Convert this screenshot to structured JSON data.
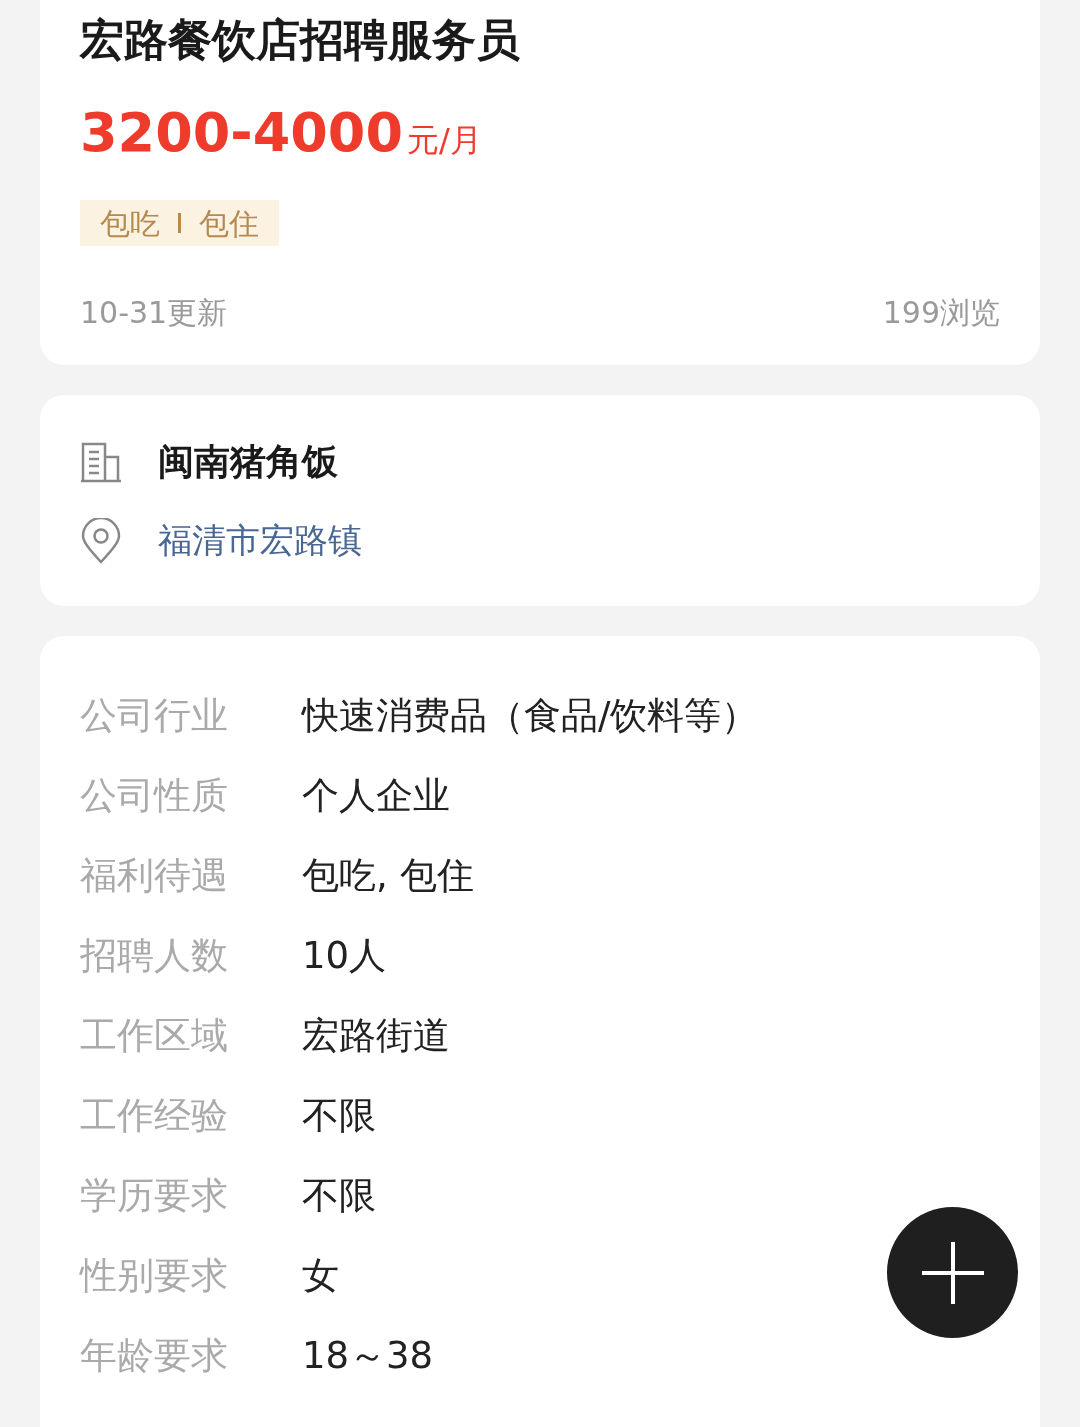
{
  "job": {
    "title": "宏路餐饮店招聘服务员",
    "salary": "3200-4000",
    "salary_unit": "元/月",
    "tags": [
      "包吃",
      "包住"
    ],
    "updated": "10-31更新",
    "views": "199浏览"
  },
  "company": {
    "name": "闽南猪角饭",
    "address": "福清市宏路镇"
  },
  "details": [
    {
      "label": "公司行业",
      "value": "快速消费品（食品/饮料等）"
    },
    {
      "label": "公司性质",
      "value": "个人企业"
    },
    {
      "label": "福利待遇",
      "value": "包吃, 包住"
    },
    {
      "label": "招聘人数",
      "value": "10人"
    },
    {
      "label": "工作区域",
      "value": "宏路街道"
    },
    {
      "label": "工作经验",
      "value": "不限"
    },
    {
      "label": "学历要求",
      "value": "不限"
    },
    {
      "label": "性别要求",
      "value": "女"
    },
    {
      "label": "年龄要求",
      "value": "18～38"
    }
  ]
}
